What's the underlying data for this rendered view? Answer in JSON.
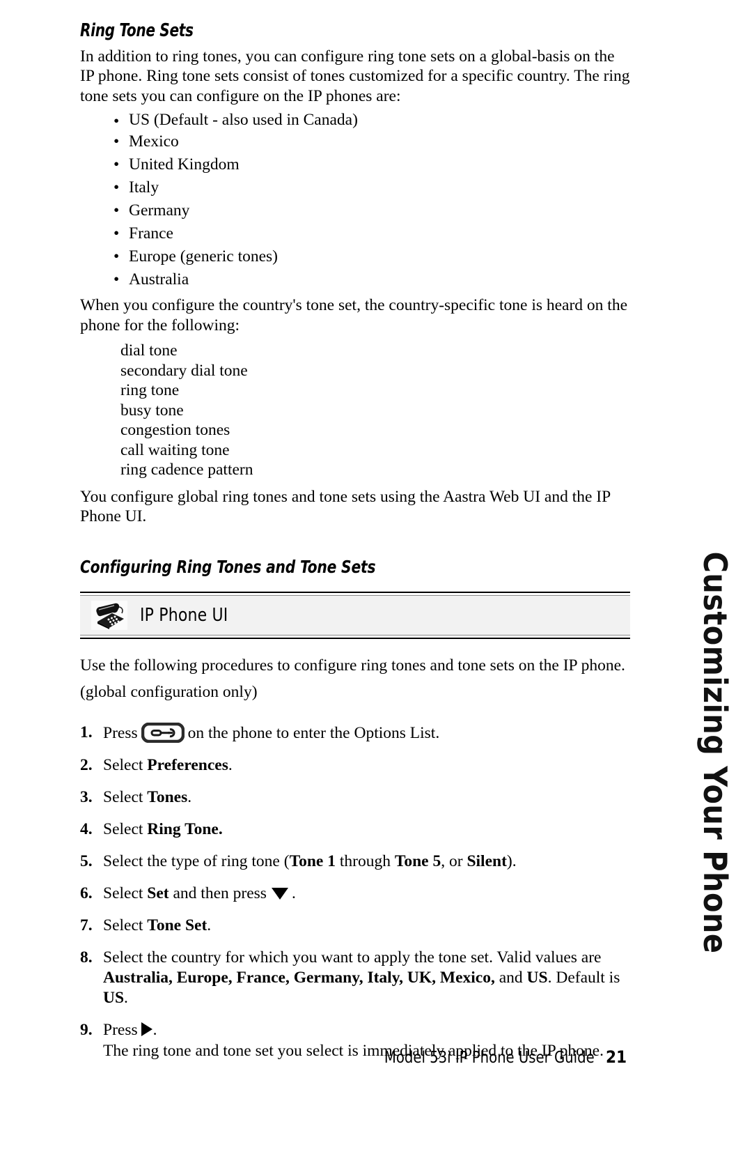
{
  "section": {
    "heading": "Ring Tone Sets",
    "intro": "In addition to ring tones, you can configure ring tone sets on a global-basis on the IP phone. Ring tone sets consist of tones customized for a specific country. The ring tone sets you can configure on the IP phones are:",
    "tone_set_countries": [
      "US (Default - also used in Canada)",
      "Mexico",
      "United Kingdom",
      "Italy",
      "Germany",
      "France",
      "Europe (generic tones)",
      "Australia"
    ],
    "bullet_glyph": "•",
    "country_tone_intro": "When you configure the country's tone set, the country-specific tone is heard on the phone for the following:",
    "affected_tones": [
      "dial tone",
      "secondary dial tone",
      "ring tone",
      "busy tone",
      "congestion tones",
      "call waiting tone",
      "ring cadence pattern"
    ],
    "closing": "You configure global ring tones and tone sets using the Aastra Web UI and the IP Phone UI."
  },
  "subsection": {
    "heading": "Configuring Ring Tones and Tone Sets"
  },
  "banner": {
    "label": "IP Phone UI",
    "icon_name": "desk-phone-icon",
    "background": "#f2f2f2"
  },
  "procedure": {
    "lead_line1": "Use the following procedures to configure ring tones and tone sets on the IP phone.",
    "lead_line2": "(global configuration only)",
    "steps": [
      {
        "num": "1.",
        "pre": "Press",
        "icon": "options-key-icon",
        "post": "on the phone to enter the Options List."
      },
      {
        "num": "2.",
        "pre": "Select",
        "bold": "Preferences",
        "post": "."
      },
      {
        "num": "3.",
        "pre": "Select",
        "bold": "Tones",
        "post": "."
      },
      {
        "num": "4.",
        "pre": "Select",
        "bold": "Ring Tone.",
        "post": ""
      },
      {
        "num": "5.",
        "pre": "Select the type of ring tone (",
        "bold1": "Tone 1",
        "mid1": " through ",
        "bold2": "Tone 5",
        "mid2": ", or ",
        "bold3": "Silent",
        "post": ")."
      },
      {
        "num": "6.",
        "pre": "Select",
        "bold": "Set",
        "mid": "and then press",
        "icon": "triangle-down-icon",
        "post": "."
      },
      {
        "num": "7.",
        "pre": "Select",
        "bold": "Tone Set",
        "post": "."
      },
      {
        "num": "8.",
        "pre": "Select the country for which you want to apply the tone set. Valid values are ",
        "bold_list": "Australia, Europe, France, Germany, Italy, UK, Mexico,",
        "mid": " and ",
        "bold_us": "US",
        "mid2": ". Default is ",
        "bold_default": "US",
        "post": "."
      },
      {
        "num": "9.",
        "pre": "Press",
        "icon": "triangle-right-icon",
        "post": ".",
        "sub": "The ring tone and tone set you select is immediately applied to the IP phone."
      }
    ]
  },
  "sidetab": {
    "label": "Customizing Your Phone"
  },
  "footer": {
    "title": "Model 53i IP Phone User Guide",
    "page_number": "21"
  }
}
